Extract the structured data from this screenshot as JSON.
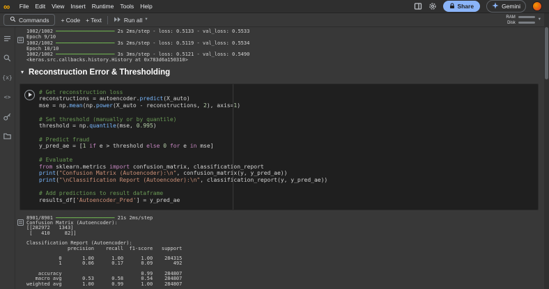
{
  "menubar": {
    "menus": [
      "File",
      "Edit",
      "View",
      "Insert",
      "Runtime",
      "Tools",
      "Help"
    ],
    "share_label": "Share",
    "gemini_label": "Gemini"
  },
  "toolbar": {
    "commands_label": "Commands",
    "add_code_label": "+ Code",
    "add_text_label": "+ Text",
    "run_all_label": "Run all",
    "ram_label": "RAM",
    "disk_label": "Disk"
  },
  "rail_icons": [
    "table-of-contents",
    "search",
    "variables",
    "code-snippets",
    "secrets",
    "files"
  ],
  "notebook": {
    "previous_output_lines": [
      [
        [
          "plain",
          "1002/1002 "
        ],
        [
          "bar",
          "━━━━━━━━━━━━━━━━━━━━"
        ],
        [
          "plain",
          " 2s 2ms/step - loss: 0.5133 - val_loss: 0.5533"
        ]
      ],
      [
        [
          "plain",
          "Epoch 9/10"
        ]
      ],
      [
        [
          "plain",
          "1002/1002 "
        ],
        [
          "bar",
          "━━━━━━━━━━━━━━━━━━━━"
        ],
        [
          "plain",
          " 3s 2ms/step - loss: 0.5119 - val_loss: 0.5534"
        ]
      ],
      [
        [
          "plain",
          "Epoch 10/10"
        ]
      ],
      [
        [
          "plain",
          "1002/1002 "
        ],
        [
          "bar",
          "━━━━━━━━━━━━━━━━━━━━"
        ],
        [
          "plain",
          " 3s 3ms/step - loss: 0.5121 - val_loss: 0.5490"
        ]
      ],
      [
        [
          "plain",
          "<keras.src.callbacks.history.History at 0x783d6a150310>"
        ]
      ]
    ],
    "section_title": "Reconstruction Error & Thresholding",
    "code_lines": [
      [
        [
          "comment",
          "# Get reconstruction loss"
        ]
      ],
      [
        [
          "plain",
          "reconstructions = autoencoder."
        ],
        [
          "func",
          "predict"
        ],
        [
          "plain",
          "(X_auto)"
        ]
      ],
      [
        [
          "plain",
          "mse = np."
        ],
        [
          "func",
          "mean"
        ],
        [
          "plain",
          "(np."
        ],
        [
          "func",
          "power"
        ],
        [
          "plain",
          "(X_auto - reconstructions, "
        ],
        [
          "num",
          "2"
        ],
        [
          "plain",
          "), axis="
        ],
        [
          "num",
          "1"
        ],
        [
          "plain",
          ")"
        ]
      ],
      [],
      [
        [
          "comment",
          "# Set threshold (manually or by quantile)"
        ]
      ],
      [
        [
          "plain",
          "threshold = np."
        ],
        [
          "func",
          "quantile"
        ],
        [
          "plain",
          "(mse, "
        ],
        [
          "num",
          "0.995"
        ],
        [
          "plain",
          ")"
        ]
      ],
      [],
      [
        [
          "comment",
          "# Predict fraud"
        ]
      ],
      [
        [
          "plain",
          "y_pred_ae = ["
        ],
        [
          "num",
          "1"
        ],
        [
          "kw",
          " if"
        ],
        [
          "plain",
          " e > threshold "
        ],
        [
          "kw",
          "else"
        ],
        [
          "num",
          " 0"
        ],
        [
          "kw",
          " for"
        ],
        [
          "plain",
          " e "
        ],
        [
          "kw",
          "in"
        ],
        [
          "plain",
          " mse]"
        ]
      ],
      [],
      [
        [
          "comment",
          "# Evaluate"
        ]
      ],
      [
        [
          "kw",
          "from"
        ],
        [
          "plain",
          " sklearn.metrics "
        ],
        [
          "kw",
          "import"
        ],
        [
          "plain",
          " confusion_matrix, classification_report"
        ]
      ],
      [
        [
          "func",
          "print"
        ],
        [
          "plain",
          "("
        ],
        [
          "str",
          "\"Confusion Matrix (Autoencoder):\\n\""
        ],
        [
          "plain",
          ", confusion_matrix(y, y_pred_ae))"
        ]
      ],
      [
        [
          "func",
          "print"
        ],
        [
          "plain",
          "("
        ],
        [
          "str",
          "\"\\nClassification Report (Autoencoder):\\n\""
        ],
        [
          "plain",
          ", classification_report(y, y_pred_ae))"
        ]
      ],
      [],
      [
        [
          "comment",
          "# Add predictions to result dataframe"
        ]
      ],
      [
        [
          "plain",
          "results_df["
        ],
        [
          "str",
          "'Autoencoder_Pred'"
        ],
        [
          "plain",
          "] = y_pred_ae"
        ]
      ]
    ],
    "output_lines": [
      [
        [
          "plain",
          "8901/8901 "
        ],
        [
          "bar",
          "━━━━━━━━━━━━━━━━━━━━"
        ],
        [
          "plain",
          " 21s 2ms/step"
        ]
      ],
      [
        [
          "plain",
          "Confusion Matrix (Autoencoder):"
        ]
      ],
      [
        [
          "plain",
          "[[282972   1343]"
        ]
      ],
      [
        [
          "plain",
          " [   410     82]]"
        ]
      ],
      [],
      [
        [
          "plain",
          "Classification Report (Autoencoder):"
        ]
      ],
      [
        [
          "plain",
          "              precision    recall  f1-score   support"
        ]
      ],
      [],
      [
        [
          "plain",
          "           0       1.00      1.00      1.00    284315"
        ]
      ],
      [
        [
          "plain",
          "           1       0.06      0.17      0.09       492"
        ]
      ],
      [],
      [
        [
          "plain",
          "    accuracy                           0.99    284807"
        ]
      ],
      [
        [
          "plain",
          "   macro avg       0.53      0.58      0.54    284807"
        ]
      ],
      [
        [
          "plain",
          "weighted avg       1.00      0.99      1.00    284807"
        ]
      ]
    ]
  },
  "colors": {
    "accent_blue": "#8ab4f8",
    "logo_orange": "#f9ab00",
    "comment_green": "#6a9955",
    "string_orange": "#ce9178",
    "keyword_purple": "#c586c0",
    "progress_green": "#6aa84f",
    "cell_background": "#1f1f1f",
    "page_background": "#383838"
  }
}
